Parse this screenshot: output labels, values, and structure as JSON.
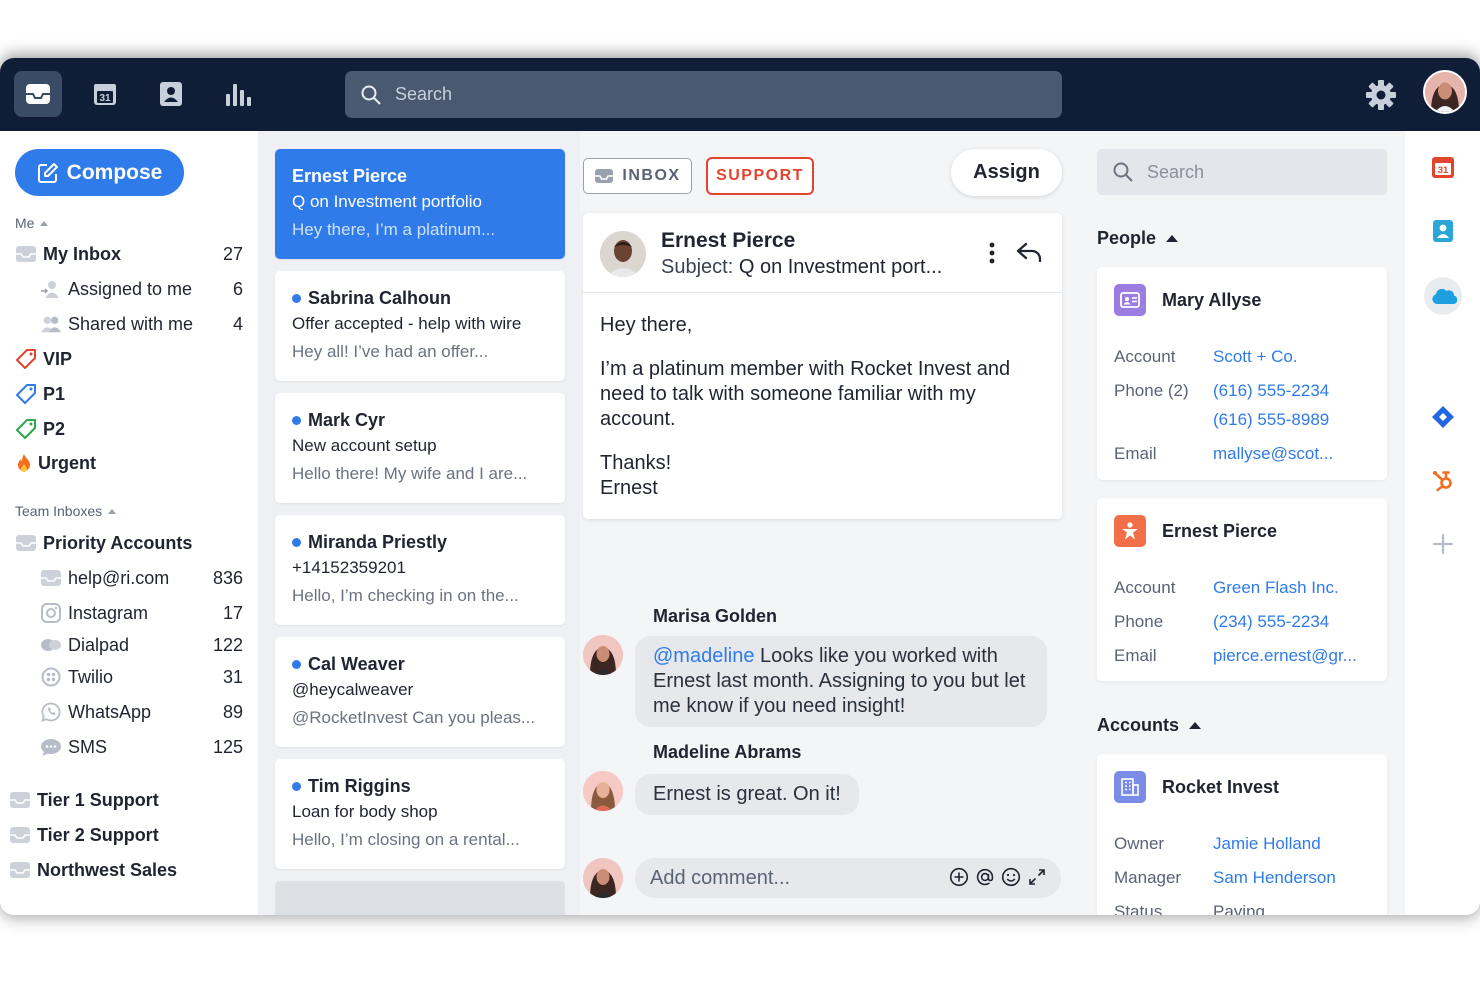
{
  "topbar": {
    "search_placeholder": "Search",
    "nav_icons": [
      "inbox-icon",
      "calendar-icon",
      "contacts-icon",
      "analytics-icon"
    ],
    "calendar_day": "31"
  },
  "sidebar": {
    "compose_label": "Compose",
    "me_label": "Me",
    "my_inbox": {
      "label": "My Inbox",
      "count": "27"
    },
    "assigned": {
      "label": "Assigned to me",
      "count": "6"
    },
    "shared": {
      "label": "Shared with me",
      "count": "4"
    },
    "tags": [
      {
        "label": "VIP",
        "color": "#e2442f"
      },
      {
        "label": "P1",
        "color": "#2f7bea"
      },
      {
        "label": "P2",
        "color": "#2aa84a"
      }
    ],
    "urgent_label": "Urgent",
    "team_label": "Team Inboxes",
    "priority_accounts": "Priority Accounts",
    "channels": [
      {
        "label": "help@ri.com",
        "count": "836"
      },
      {
        "label": "Instagram",
        "count": "17"
      },
      {
        "label": "Dialpad",
        "count": "122"
      },
      {
        "label": "Twilio",
        "count": "31"
      },
      {
        "label": "WhatsApp",
        "count": "89"
      },
      {
        "label": "SMS",
        "count": "125"
      }
    ],
    "teams": [
      "Tier 1 Support",
      "Tier 2 Support",
      "Northwest Sales"
    ]
  },
  "conversations": [
    {
      "name": "Ernest Pierce",
      "subject": "Q on Investment portfolio",
      "preview": "Hey there, I’m a platinum...",
      "selected": true
    },
    {
      "name": "Sabrina Calhoun",
      "subject": "Offer accepted - help with wire",
      "preview": "Hey all! I’ve had an offer..."
    },
    {
      "name": "Mark Cyr",
      "subject": "New account setup",
      "preview": "Hello there! My wife and I are..."
    },
    {
      "name": "Miranda Priestly",
      "subject": "+14152359201",
      "preview": "Hello, I’m checking in on the..."
    },
    {
      "name": "Cal Weaver",
      "subject": "@heycalweaver",
      "preview": "@RocketInvest Can you pleas..."
    },
    {
      "name": "Tim Riggins",
      "subject": "Loan for body shop",
      "preview": "Hello, I’m closing on a rental..."
    }
  ],
  "message": {
    "tag_inbox": "INBOX",
    "tag_support": "SUPPORT",
    "assign_label": "Assign",
    "from": "Ernest Pierce",
    "subject_label": "Subject:",
    "subject": "Q on Investment port...",
    "body": [
      "Hey there,",
      "I’m a platinum member with Rocket Invest and need to talk with someone familiar with my account.",
      "Thanks!"
    ],
    "signature": "Ernest",
    "comments": [
      {
        "author": "Marisa Golden",
        "mention": "@madeline",
        "text": " Looks like you worked with Ernest last month. Assigning to you but let me know if you need insight!"
      },
      {
        "author": "Madeline Abrams",
        "text": "Ernest is great. On it!"
      }
    ],
    "comment_placeholder": "Add comment..."
  },
  "right_panel": {
    "search_placeholder": "Search",
    "people_label": "People",
    "people": [
      {
        "name": "Mary Allyse",
        "icon": "contact-card-icon",
        "icon_color": "#9b7ee0",
        "fields": [
          {
            "key": "Account",
            "values": [
              "Scott + Co."
            ]
          },
          {
            "key": "Phone (2)",
            "values": [
              "(616) 555-2234",
              "(616) 555-8989"
            ]
          },
          {
            "key": "Email",
            "values": [
              "mallyse@scot..."
            ]
          }
        ]
      },
      {
        "name": "Ernest Pierce",
        "icon": "star-person-icon",
        "icon_color": "#f26f4a",
        "fields": [
          {
            "key": "Account",
            "values": [
              "Green Flash Inc."
            ]
          },
          {
            "key": "Phone",
            "values": [
              "(234) 555-2234"
            ]
          },
          {
            "key": "Email",
            "values": [
              "pierce.ernest@gr..."
            ]
          }
        ]
      }
    ],
    "accounts_label": "Accounts",
    "account": {
      "name": "Rocket Invest",
      "icon": "building-icon",
      "icon_color": "#7a8ce8",
      "fields": [
        {
          "key": "Owner",
          "values": [
            "Jamie Holland"
          ]
        },
        {
          "key": "Manager",
          "values": [
            "Sam Henderson"
          ]
        },
        {
          "key": "Status",
          "values": [
            "Paying"
          ]
        }
      ]
    }
  },
  "rail": {
    "calendar_day": "31",
    "apps": [
      "calendar-app-icon",
      "contacts-app-icon",
      "salesforce-icon",
      "jira-icon",
      "hubspot-icon",
      "add-app-icon"
    ]
  },
  "colors": {
    "topbar": "#0f1d36",
    "accent": "#2f7bea",
    "support_tag": "#e2442f"
  }
}
